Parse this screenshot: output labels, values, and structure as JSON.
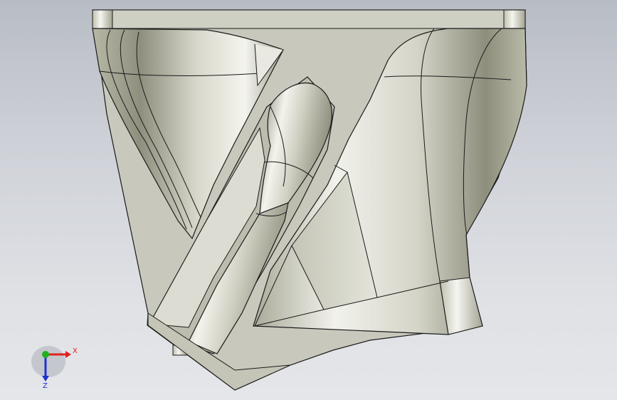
{
  "view": {
    "background_top": "#b8bcc4",
    "background_bottom": "#e4e6ea",
    "model_face_color": "#c9c9bd",
    "edge_color": "#1a1a1a"
  },
  "triad": {
    "x_label": "X",
    "z_label": "Z",
    "x_color": "#e02020",
    "y_color": "#20b020",
    "z_color": "#2030d0"
  }
}
